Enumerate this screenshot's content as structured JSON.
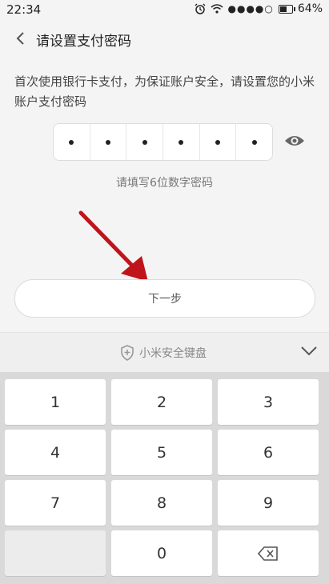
{
  "status": {
    "time": "22:34",
    "battery": "64%",
    "icons": [
      "alarm-icon",
      "wifi-icon",
      "signal-icon",
      "battery-icon"
    ]
  },
  "header": {
    "title": "请设置支付密码"
  },
  "instruction": "首次使用银行卡支付，为保证账户安全，请设置您的小米账户支付密码",
  "pin": {
    "length": 6,
    "entered": 6
  },
  "hint": "请填写6位数字密码",
  "next_button": "下一步",
  "keyboard": {
    "title": "小米安全键盘",
    "keys": {
      "k1": "1",
      "k2": "2",
      "k3": "3",
      "k4": "4",
      "k5": "5",
      "k6": "6",
      "k7": "7",
      "k8": "8",
      "k9": "9",
      "k0": "0"
    }
  },
  "colors": {
    "arrow": "#c0141b"
  }
}
